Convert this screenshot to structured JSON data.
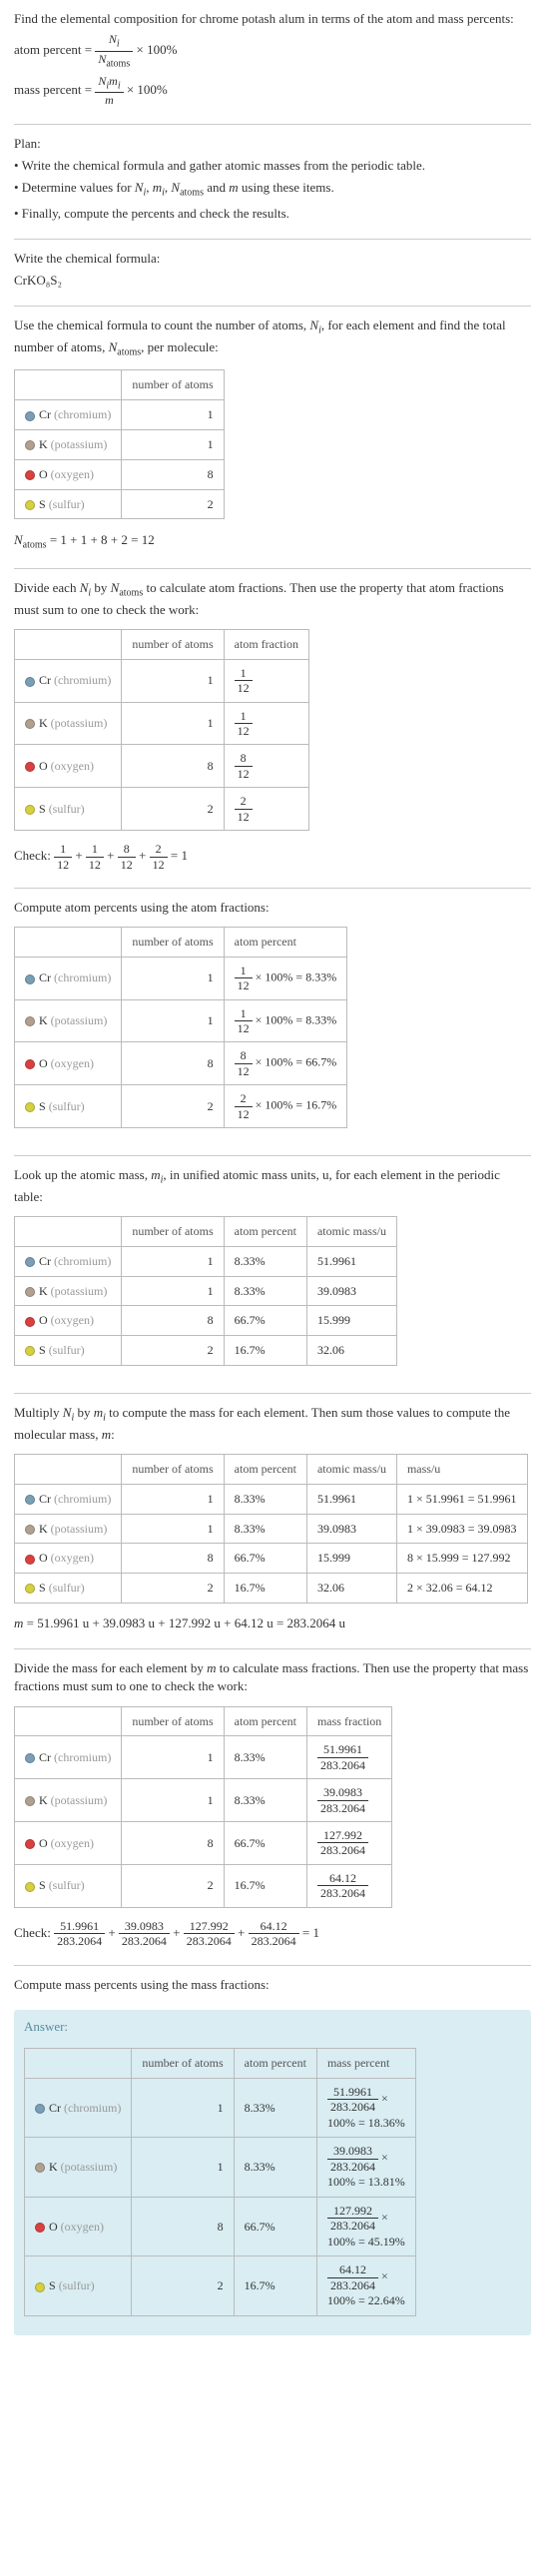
{
  "intro": {
    "line1": "Find the elemental composition for chrome potash alum in terms of the atom and mass percents:",
    "atom_percent_label": "atom percent =",
    "mass_percent_label": "mass percent =",
    "times100": "× 100%"
  },
  "plan": {
    "title": "Plan:",
    "b1": "• Write the chemical formula and gather atomic masses from the periodic table.",
    "b2_a": "• Determine values for ",
    "b2_b": " using these items.",
    "b3": "• Finally, compute the percents and check the results."
  },
  "formula_section": {
    "title": "Write the chemical formula:",
    "formula": "CrKO₈S₂"
  },
  "count_section": {
    "intro_a": "Use the chemical formula to count the number of atoms, ",
    "intro_b": ", for each element and find the total number of atoms, ",
    "intro_c": ", per molecule:",
    "col_num": "number of atoms",
    "n_atoms_eq": " = 1 + 1 + 8 + 2 = 12"
  },
  "elements": {
    "cr": {
      "sym": "Cr",
      "name": "(chromium)",
      "n": "1"
    },
    "k": {
      "sym": "K",
      "name": "(potassium)",
      "n": "1"
    },
    "o": {
      "sym": "O",
      "name": "(oxygen)",
      "n": "8"
    },
    "s": {
      "sym": "S",
      "name": "(sulfur)",
      "n": "2"
    }
  },
  "divide_section": {
    "intro_a": "Divide each ",
    "intro_b": " by ",
    "intro_c": " to calculate atom fractions. Then use the property that atom fractions must sum to one to check the work:",
    "col_frac": "atom fraction",
    "check_label": "Check: ",
    "check_eq": " = 1"
  },
  "fractions": {
    "cr": {
      "num": "1",
      "den": "12"
    },
    "k": {
      "num": "1",
      "den": "12"
    },
    "o": {
      "num": "8",
      "den": "12"
    },
    "s": {
      "num": "2",
      "den": "12"
    }
  },
  "atom_pct_section": {
    "intro": "Compute atom percents using the atom fractions:",
    "col_pct": "atom percent",
    "cr_pct": "× 100% = 8.33%",
    "k_pct": "× 100% = 8.33%",
    "o_pct": "× 100% = 66.7%",
    "s_pct": "× 100% = 16.7%"
  },
  "atomic_mass_section": {
    "intro_a": "Look up the atomic mass, ",
    "intro_b": ", in unified atomic mass units, u, for each element in the periodic table:",
    "col_mass": "atomic mass/u",
    "cr_pct": "8.33%",
    "cr_mass": "51.9961",
    "k_pct": "8.33%",
    "k_mass": "39.0983",
    "o_pct": "66.7%",
    "o_mass": "15.999",
    "s_pct": "16.7%",
    "s_mass": "32.06"
  },
  "multiply_section": {
    "intro_a": "Multiply ",
    "intro_b": " by ",
    "intro_c": " to compute the mass for each element. Then sum those values to compute the molecular mass, ",
    "intro_d": ":",
    "col_massu": "mass/u",
    "cr_calc": "1 × 51.9961 = 51.9961",
    "k_calc": "1 × 39.0983 = 39.0983",
    "o_calc": "8 × 15.999 = 127.992",
    "s_calc": "2 × 32.06 = 64.12",
    "m_eq": " = 51.9961 u + 39.0983 u + 127.992 u + 64.12 u = 283.2064 u"
  },
  "mass_frac_section": {
    "intro_a": "Divide the mass for each element by ",
    "intro_b": " to calculate mass fractions. Then use the property that mass fractions must sum to one to check the work:",
    "col_mf": "mass fraction",
    "cr_num": "51.9961",
    "k_num": "39.0983",
    "o_num": "127.992",
    "s_num": "64.12",
    "den": "283.2064",
    "check_label": "Check: ",
    "check_eq": " = 1"
  },
  "mass_pct_section": {
    "intro": "Compute mass percents using the mass fractions:"
  },
  "answer": {
    "label": "Answer:",
    "col_mp": "mass percent",
    "cr_res": "100% = 18.36%",
    "k_res": "100% = 13.81%",
    "o_res": "100% = 45.19%",
    "s_res": "100% = 22.64%",
    "times": " ×"
  }
}
